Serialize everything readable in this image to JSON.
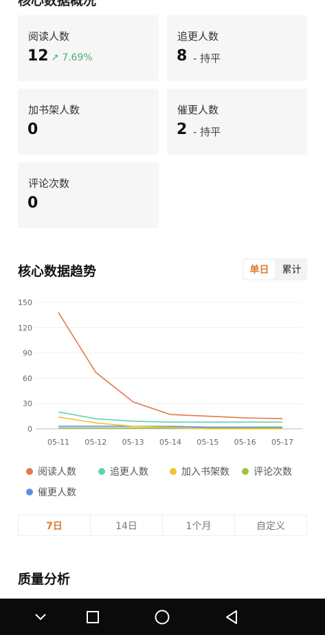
{
  "top_section_title": "核心数据概况",
  "cards": [
    {
      "label": "阅读人数",
      "value": "12",
      "change": "7.69%",
      "change_type": "up"
    },
    {
      "label": "追更人数",
      "value": "8",
      "change": "- 持平",
      "change_type": "flat"
    },
    {
      "label": "加书架人数",
      "value": "0",
      "change": "",
      "change_type": "none"
    },
    {
      "label": "催更人数",
      "value": "2",
      "change": "- 持平",
      "change_type": "flat"
    },
    {
      "label": "评论次数",
      "value": "0",
      "change": "",
      "change_type": "none"
    }
  ],
  "trend": {
    "title": "核心数据趋势",
    "toggle": {
      "single": "单日",
      "cumulative": "累计",
      "selected": "single"
    }
  },
  "chart_data": {
    "type": "line",
    "x": [
      "05-11",
      "05-12",
      "05-13",
      "05-14",
      "05-15",
      "05-16",
      "05-17"
    ],
    "yticks": [
      0,
      30,
      60,
      90,
      120,
      150
    ],
    "ylim": [
      0,
      150
    ],
    "grid": true,
    "legend_position": "bottom",
    "series": [
      {
        "name": "阅读人数",
        "color": "#e07a4a",
        "values": [
          138,
          67,
          32,
          17,
          15,
          13,
          12
        ]
      },
      {
        "name": "追更人数",
        "color": "#5fd3b0",
        "values": [
          20,
          12,
          9,
          8,
          8,
          8,
          8
        ]
      },
      {
        "name": "加入书架数",
        "color": "#f2c230",
        "values": [
          14,
          7,
          3,
          2,
          0,
          0,
          0
        ]
      },
      {
        "name": "评论次数",
        "color": "#9bc43a",
        "values": [
          1,
          1,
          1,
          1,
          1,
          1,
          1
        ]
      },
      {
        "name": "催更人数",
        "color": "#5b8ee6",
        "values": [
          3,
          3,
          3,
          3,
          2,
          2,
          2
        ]
      }
    ]
  },
  "ranges": [
    "7日",
    "14日",
    "1个月",
    "自定义"
  ],
  "ranges_selected": 0,
  "quality_title": "质量分析"
}
